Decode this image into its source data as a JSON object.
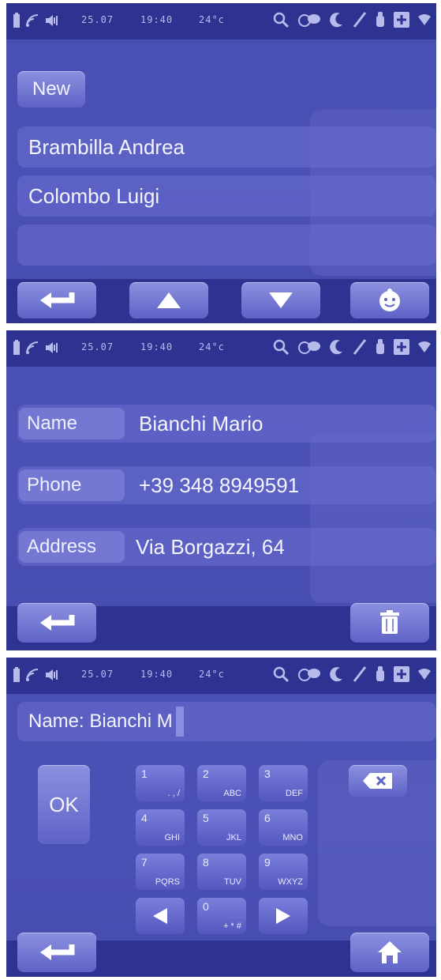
{
  "status": {
    "date": "25.07",
    "time": "19:40",
    "temperature": "24°c"
  },
  "screen1": {
    "new_label": "New",
    "contacts": [
      "Brambilla Andrea",
      "Colombo Luigi",
      ""
    ]
  },
  "screen2": {
    "fields": [
      {
        "label": "Name",
        "value": "Bianchi Mario"
      },
      {
        "label": "Phone",
        "value": "+39 348 8949591"
      },
      {
        "label": "Address",
        "value": "Via Borgazzi, 64"
      }
    ]
  },
  "screen3": {
    "input_value": "Name: Bianchi M",
    "ok_label": "OK",
    "keys": [
      {
        "digit": "1",
        "letters": ". , /"
      },
      {
        "digit": "2",
        "letters": "ABC"
      },
      {
        "digit": "3",
        "letters": "DEF"
      },
      {
        "digit": "4",
        "letters": "GHI"
      },
      {
        "digit": "5",
        "letters": "JKL"
      },
      {
        "digit": "6",
        "letters": "MNO"
      },
      {
        "digit": "7",
        "letters": "PQRS"
      },
      {
        "digit": "8",
        "letters": "TUV"
      },
      {
        "digit": "9",
        "letters": "WXYZ"
      },
      {
        "digit": "0",
        "letters": "+ * #"
      }
    ]
  },
  "icons": {
    "back": "back-arrow-icon",
    "up": "up-arrow-icon",
    "down": "down-arrow-icon",
    "face": "face-icon",
    "trash": "trash-icon",
    "home": "home-icon",
    "backspace": "backspace-icon",
    "left": "left-arrow-icon",
    "right": "right-arrow-icon"
  },
  "colors": {
    "panel": "#4a4fb3",
    "bar": "#2e3392",
    "button": "#7a7edb"
  }
}
